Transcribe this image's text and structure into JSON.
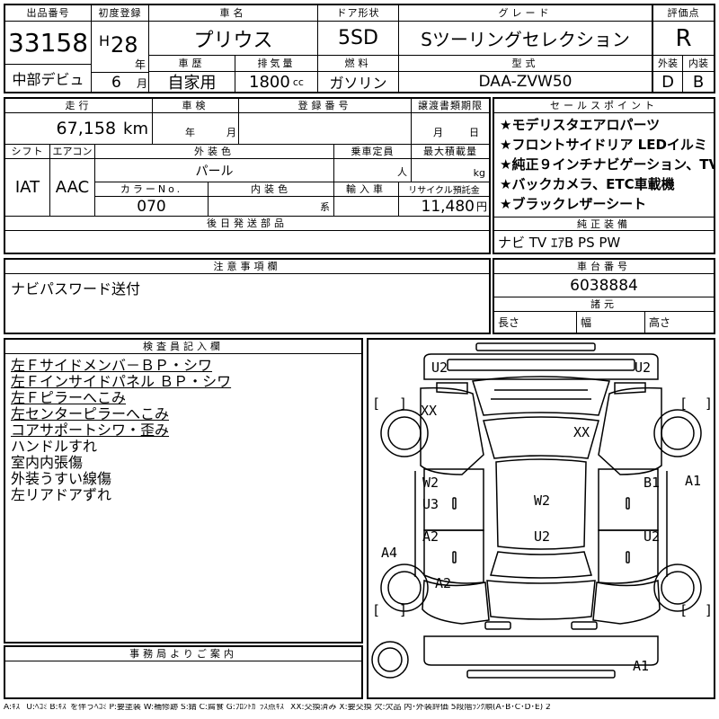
{
  "header": {
    "lot_label": "出品番号",
    "lot_no": "33158",
    "debut": "中部デビュ",
    "first_reg_label": "初度登録",
    "era": "H",
    "year": "28",
    "year_unit": "年",
    "month": "6",
    "month_unit": "月",
    "name_label": "車名",
    "name": "プリウス",
    "history_label": "車歴",
    "history": "自家用",
    "disp_label": "排気量",
    "disp": "1800",
    "disp_unit": "cc",
    "door_label": "ドア形状",
    "door": "5SD",
    "fuel_label": "燃料",
    "fuel": "ガソリン",
    "grade_label": "グレード",
    "grade": "Sツーリングセレクション",
    "model_label": "型式",
    "model": "DAA-ZVW50",
    "eval_label": "評価点",
    "score": "R",
    "ext_label": "外装",
    "ext": "D",
    "int_label": "内装",
    "int": "B"
  },
  "row2": {
    "mileage_label": "走行",
    "mileage": "67,158",
    "mileage_unit": "km",
    "inspect_label": "車検",
    "inspect_y": "年",
    "inspect_m": "月",
    "reg_label": "登録番号",
    "transfer_label": "譲渡書類期限",
    "transfer_m": "月",
    "transfer_d": "日",
    "shift_label": "シフト",
    "shift": "IAT",
    "ac_label": "エアコン",
    "ac": "AAC",
    "color_label": "外装色",
    "color": "パール",
    "cap_label": "乗車定員",
    "cap_unit": "人",
    "load_label": "最大積載量",
    "load_unit": "kg",
    "colorno_label": "カラーNo.",
    "colorno": "070",
    "intcolor_label": "内装色",
    "intcolor_unit": "系",
    "import_label": "輸入車",
    "recycle_label": "リサイクル預託金",
    "recycle": "11,480",
    "recycle_unit": "円",
    "later_label": "後日発送部品"
  },
  "sales": {
    "label": "セールスポイント",
    "points": [
      "★モデリスタエアロパーツ",
      "★フロントサイドリア LEDイルミ",
      "★純正９インチナビゲーション、TV",
      "★バックカメラ、ETC車載機",
      "★ブラックレザーシート"
    ]
  },
  "equip": {
    "label": "純正装備",
    "value": "ナビ TV ｴｱB PS PW"
  },
  "notes": {
    "label": "注意事項欄",
    "value": "ナビパスワード送付"
  },
  "chassis": {
    "label": "車台番号",
    "value": "6038884",
    "dims_label": "諸元",
    "len": "長さ",
    "wid": "幅",
    "hgt": "高さ"
  },
  "inspector": {
    "label": "検査員記入欄",
    "lines": [
      {
        "text": "左Ｆサイドメンバ－ＢＰ・シワ",
        "underline": true
      },
      {
        "text": "左Ｆインサイドパネル ＢＰ・シワ",
        "underline": true
      },
      {
        "text": "左Ｆピラーへこみ",
        "underline": true
      },
      {
        "text": "左センターピラーへこみ",
        "underline": true
      },
      {
        "text": "コアサポートシワ・歪み",
        "underline": true
      },
      {
        "text": "ハンドルすれ",
        "underline": false
      },
      {
        "text": "室内内張傷",
        "underline": false
      },
      {
        "text": "外装うすい線傷",
        "underline": false
      },
      {
        "text": "左リアドアずれ",
        "underline": false
      }
    ]
  },
  "office": {
    "label": "事務局よりご案内"
  },
  "diagram": {
    "marks": [
      "U2",
      "U2",
      "XX",
      "XX",
      "W2",
      "U3",
      "W2",
      "B1",
      "A1",
      "A2",
      "U2",
      "U2",
      "A4",
      "A2",
      "A1"
    ],
    "brackets": [
      "[",
      "]",
      "[",
      "]",
      "[",
      "]",
      "[",
      "]"
    ]
  },
  "legend": "A:ｷｽﾞ U:ﾍｺﾐ B:ｷｽﾞを伴うﾍｺﾐ P:要塗装 W:補修跡 S:錆 C:腐食 G:ﾌﾛﾝﾄｶﾞﾗｽ点ｷｽﾞ XX:交換済み X:要交換 欠:欠品 内･外装評価 5段階ﾗﾝｸ順(A･B･C･D･E) 2"
}
